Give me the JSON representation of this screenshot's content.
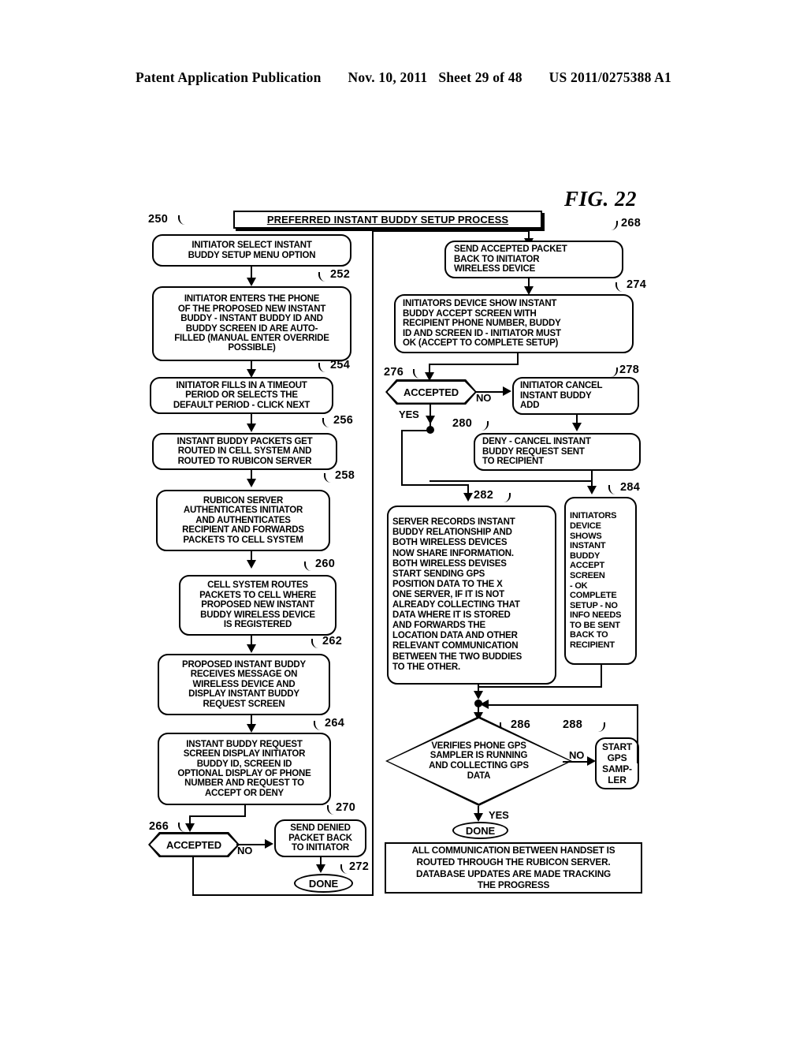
{
  "header": {
    "left": "Patent Application Publication",
    "date": "Nov. 10, 2011",
    "sheet": "Sheet 29 of 48",
    "number": "US 2011/0275388 A1"
  },
  "figure": {
    "label": "FIG. 22",
    "title": "PREFERRED INSTANT BUDDY SETUP PROCESS"
  },
  "nodes": {
    "n250": {
      "ref": "250",
      "text": "INITIATOR SELECT INSTANT\nBUDDY SETUP MENU OPTION"
    },
    "n252": {
      "ref": "252",
      "text": "INITIATOR ENTERS THE PHONE\nOF THE PROPOSED NEW INSTANT\nBUDDY - INSTANT BUDDY ID AND\nBUDDY SCREEN ID ARE AUTO-\nFILLED (MANUAL ENTER OVERRIDE\nPOSSIBLE)"
    },
    "n254": {
      "ref": "254",
      "text": "INITIATOR FILLS IN A TIMEOUT\nPERIOD OR SELECTS THE\nDEFAULT PERIOD - CLICK NEXT"
    },
    "n256": {
      "ref": "256",
      "text": "INSTANT BUDDY PACKETS GET\nROUTED IN CELL SYSTEM AND\nROUTED TO RUBICON SERVER"
    },
    "n258": {
      "ref": "258",
      "text": "RUBICON SERVER\nAUTHENTICATES INITIATOR\nAND AUTHENTICATES\nRECIPIENT AND FORWARDS\nPACKETS TO CELL SYSTEM"
    },
    "n260": {
      "ref": "260",
      "text": "CELL SYSTEM ROUTES\nPACKETS  TO CELL WHERE\nPROPOSED NEW  INSTANT\nBUDDY WIRELESS DEVICE\nIS REGISTERED"
    },
    "n262": {
      "ref": "262",
      "text": "PROPOSED INSTANT BUDDY\nRECEIVES MESSAGE ON\nWIRELESS DEVICE AND\nDISPLAY INSTANT BUDDY\nREQUEST SCREEN"
    },
    "n264": {
      "ref": "264",
      "text": "INSTANT BUDDY REQUEST\nSCREEN DISPLAY INITIATOR\nBUDDY ID, SCREEN ID\nOPTIONAL DISPLAY OF PHONE\nNUMBER AND REQUEST TO\nACCEPT OR DENY"
    },
    "n266": {
      "ref": "266",
      "text": "ACCEPTED",
      "no_label": "NO",
      "yes_label": ""
    },
    "n270": {
      "ref": "270",
      "text": "SEND DENIED\nPACKET BACK\nTO INITIATOR"
    },
    "n272": {
      "ref": "272",
      "text": "DONE"
    },
    "n268": {
      "ref": "268",
      "text": "SEND ACCEPTED PACKET\nBACK TO INITIATOR\nWIRELESS DEVICE"
    },
    "n274": {
      "ref": "274",
      "text": "INITIATORS DEVICE SHOW INSTANT\nBUDDY ACCEPT SCREEN WITH\nRECIPIENT PHONE NUMBER, BUDDY\nID AND SCREEN ID - INITIATOR MUST\nOK (ACCEPT TO COMPLETE SETUP)"
    },
    "n276": {
      "ref": "276",
      "text": "ACCEPTED",
      "no_label": "NO",
      "yes_label": "YES"
    },
    "n278": {
      "ref": "278",
      "text": "INITIATOR CANCEL\nINSTANT BUDDY\nADD"
    },
    "n280": {
      "ref": "280",
      "text": "DENY - CANCEL INSTANT\nBUDDY REQUEST SENT\nTO RECIPIENT"
    },
    "n282": {
      "ref": "282",
      "text": "SERVER RECORDS INSTANT\nBUDDY RELATIONSHIP AND\nBOTH WIRELESS DEVICES\nNOW SHARE INFORMATION.\n BOTH WIRELESS DEVISES\nSTART SENDING GPS\nPOSITION DATA TO THE X\n ONE SERVER, IF IT IS  NOT\nALREADY COLLECTING THAT\nDATA WHERE IT IS STORED\nAND FORWARDS THE\nLOCATION DATA AND OTHER\nRELEVANT COMMUNICATION\nBETWEEN THE TWO BUDDIES\nTO THE OTHER."
    },
    "n284": {
      "ref": "284",
      "text": "INITIATORS\nDEVICE\nSHOWS\nINSTANT\nBUDDY\nACCEPT\nSCREEN\n- OK\nCOMPLETE\nSETUP - NO\nINFO NEEDS\nTO BE SENT\nBACK TO\nRECIPIENT"
    },
    "n286": {
      "ref": "286",
      "text": "VERIFIES PHONE GPS\nSAMPLER IS RUNNING\nAND COLLECTING GPS\nDATA",
      "no_label": "NO",
      "yes_label": "YES"
    },
    "n288": {
      "ref": "288",
      "text": "START\nGPS\nSAMP-\nLER"
    },
    "n_done_right": {
      "text": "DONE"
    },
    "n_footnote": {
      "text": "ALL COMMUNICATION BETWEEN HANDSET IS\nROUTED THROUGH THE RUBICON SERVER.\nDATABASE UPDATES ARE MADE TRACKING\nTHE PROGRESS"
    }
  },
  "colors": {
    "ink": "#000000",
    "paper": "#ffffff"
  }
}
